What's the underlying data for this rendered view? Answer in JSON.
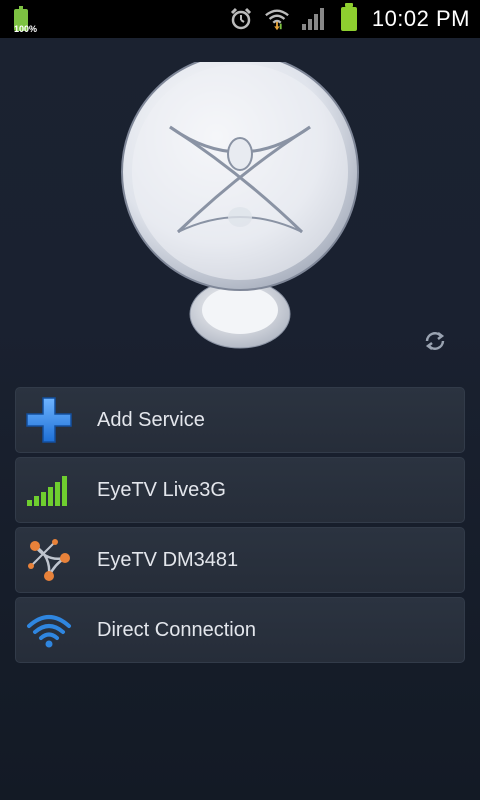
{
  "status_bar": {
    "battery_percent": "100%",
    "time": "10:02 PM",
    "icons": [
      "battery-icon",
      "alarm-icon",
      "wifi-icon",
      "signal-icon",
      "battery-icon"
    ]
  },
  "header": {
    "illustration": "satellite-dish-icon",
    "refresh_icon": "refresh-icon"
  },
  "menu": {
    "items": [
      {
        "label": "Add Service",
        "icon": "plus-icon"
      },
      {
        "label": "EyeTV Live3G",
        "icon": "cell-signal-icon"
      },
      {
        "label": "EyeTV DM3481",
        "icon": "network-nodes-icon"
      },
      {
        "label": "Direct Connection",
        "icon": "wifi-icon"
      }
    ]
  },
  "colors": {
    "background": "#1b2230",
    "item_background": "#2b3340",
    "accent_blue": "#2f86e0",
    "accent_green": "#6fce2f",
    "accent_orange": "#e8823a"
  }
}
